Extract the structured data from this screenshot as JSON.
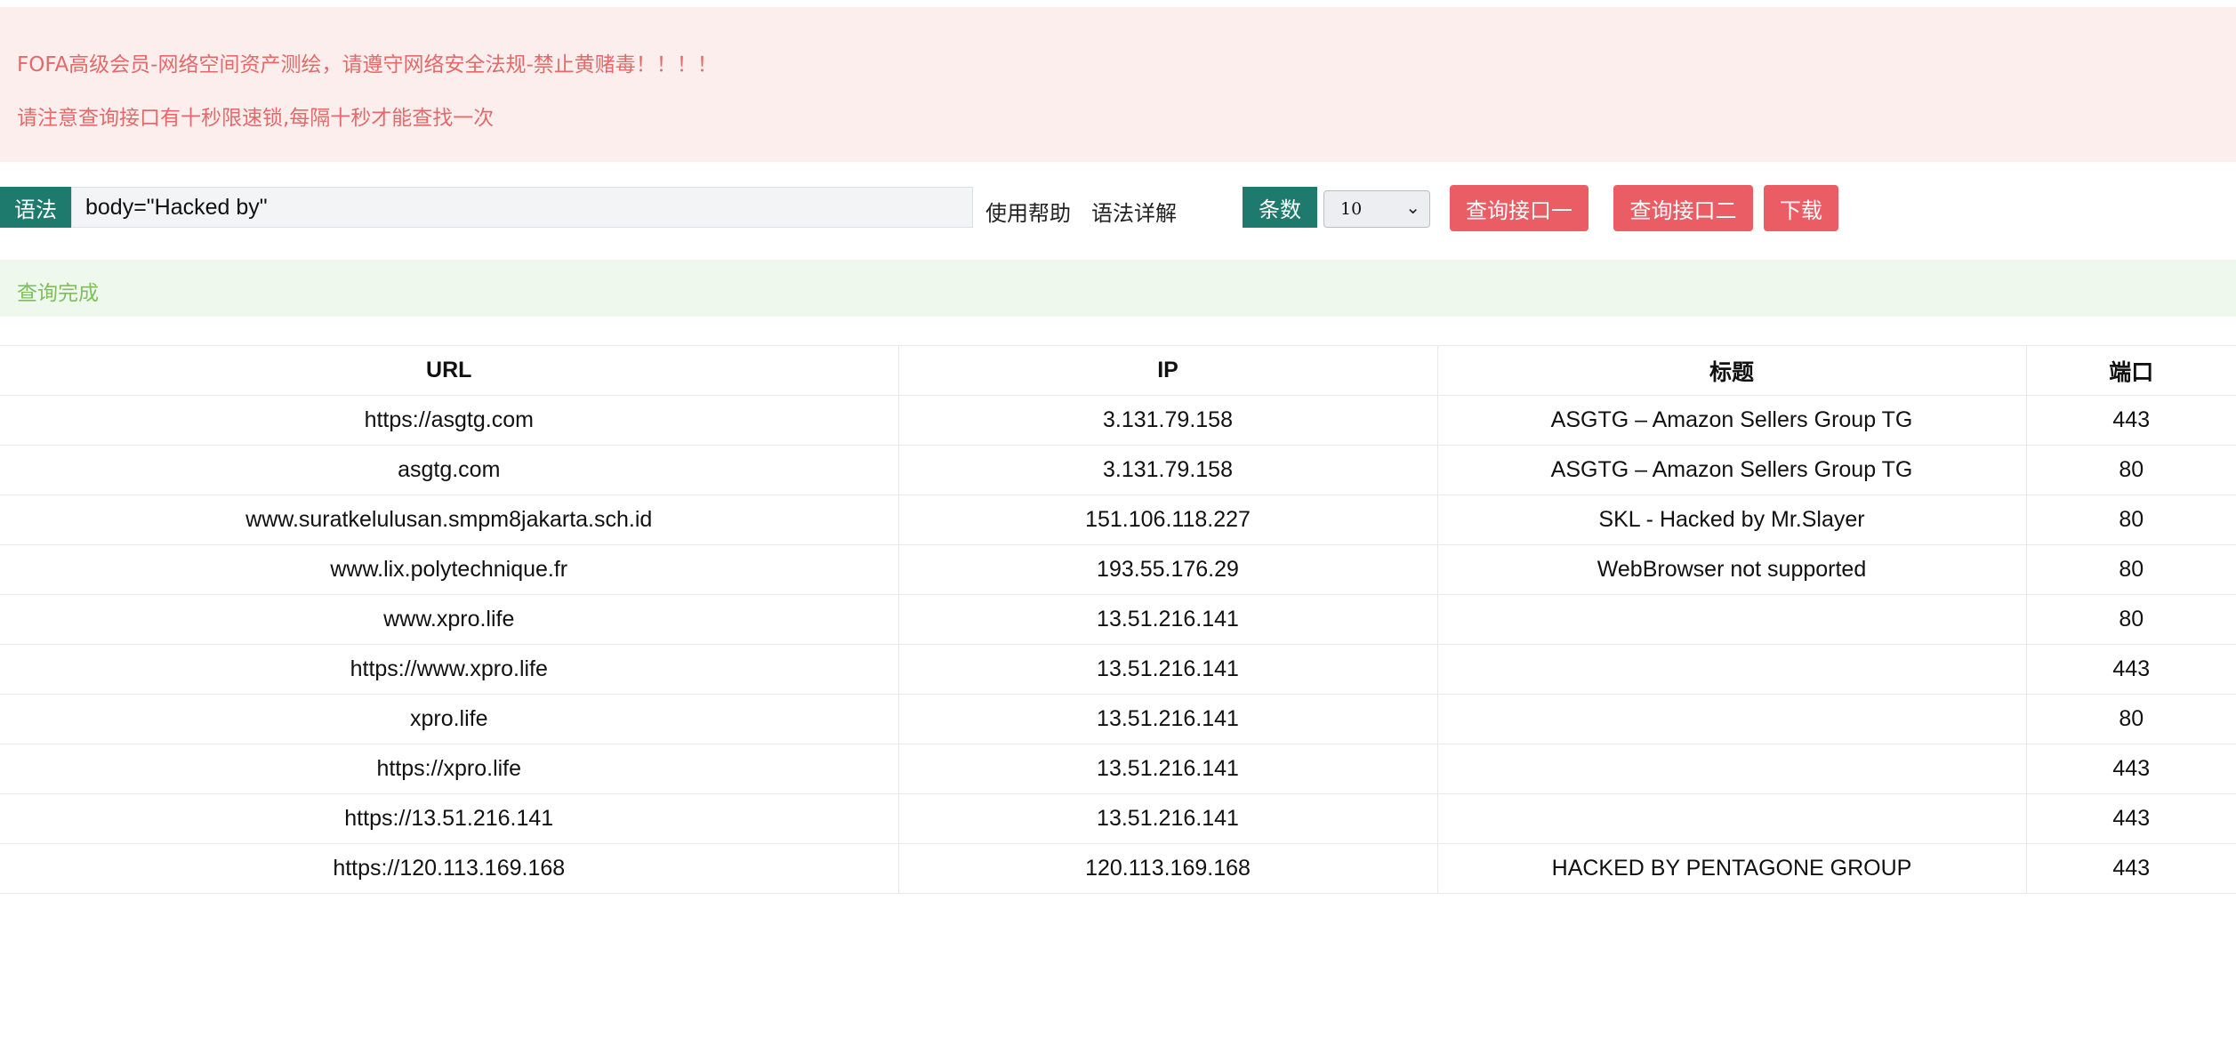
{
  "notice": {
    "line1": "FOFA高级会员-网络空间资产测绘，请遵守网络安全法规-禁止黄赌毒！！！！",
    "line2": "请注意查询接口有十秒限速锁,每隔十秒才能查找一次"
  },
  "search": {
    "syntax_label": "语法",
    "query_value": "body=\"Hacked by\"",
    "help_link": "使用帮助",
    "syntax_detail_link": "语法详解",
    "count_label": "条数",
    "count_selected": "10",
    "query_button_1": "查询接口一",
    "query_button_2": "查询接口二",
    "download_button": "下载"
  },
  "status": {
    "message": "查询完成"
  },
  "colors": {
    "tag_bg": "#1f7a6e",
    "button_bg": "#ea5d64",
    "danger_bg": "#fdeeee",
    "danger_text": "#e46a6a",
    "success_bg": "#eff8ec",
    "success_text": "#7cbf5c"
  },
  "icons": {
    "select_chevron": "chevron-down-icon"
  },
  "table": {
    "headers": [
      "URL",
      "IP",
      "标题",
      "端口"
    ],
    "rows": [
      [
        "https://asgtg.com",
        "3.131.79.158",
        "ASGTG – Amazon Sellers Group TG",
        "443"
      ],
      [
        "asgtg.com",
        "3.131.79.158",
        "ASGTG – Amazon Sellers Group TG",
        "80"
      ],
      [
        "www.suratkelulusan.smpm8jakarta.sch.id",
        "151.106.118.227",
        "SKL - Hacked by Mr.Slayer",
        "80"
      ],
      [
        "www.lix.polytechnique.fr",
        "193.55.176.29",
        "WebBrowser not supported",
        "80"
      ],
      [
        "www.xpro.life",
        "13.51.216.141",
        "",
        "80"
      ],
      [
        "https://www.xpro.life",
        "13.51.216.141",
        "",
        "443"
      ],
      [
        "xpro.life",
        "13.51.216.141",
        "",
        "80"
      ],
      [
        "https://xpro.life",
        "13.51.216.141",
        "",
        "443"
      ],
      [
        "https://13.51.216.141",
        "13.51.216.141",
        "",
        "443"
      ],
      [
        "https://120.113.169.168",
        "120.113.169.168",
        "HACKED BY PENTAGONE GROUP",
        "443"
      ]
    ]
  }
}
